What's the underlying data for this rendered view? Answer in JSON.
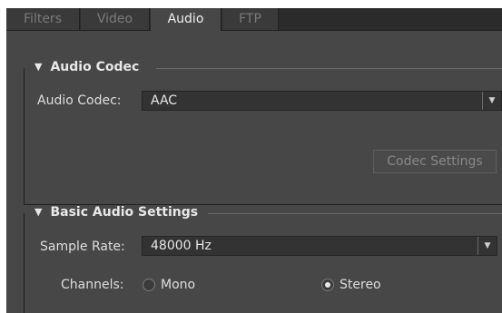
{
  "tabs": [
    {
      "label": "Filters",
      "active": false
    },
    {
      "label": "Video",
      "active": false
    },
    {
      "label": "Audio",
      "active": true
    },
    {
      "label": "FTP",
      "active": false
    }
  ],
  "audio_codec_section": {
    "title": "Audio Codec",
    "codec_label": "Audio Codec:",
    "codec_value": "AAC",
    "codec_settings_button": "Codec Settings"
  },
  "basic_audio_section": {
    "title": "Basic Audio Settings",
    "sample_rate_label": "Sample Rate:",
    "sample_rate_value": "48000 Hz",
    "channels_label": "Channels:",
    "channels_options": [
      {
        "label": "Mono",
        "selected": false
      },
      {
        "label": "Stereo",
        "selected": true
      }
    ]
  }
}
